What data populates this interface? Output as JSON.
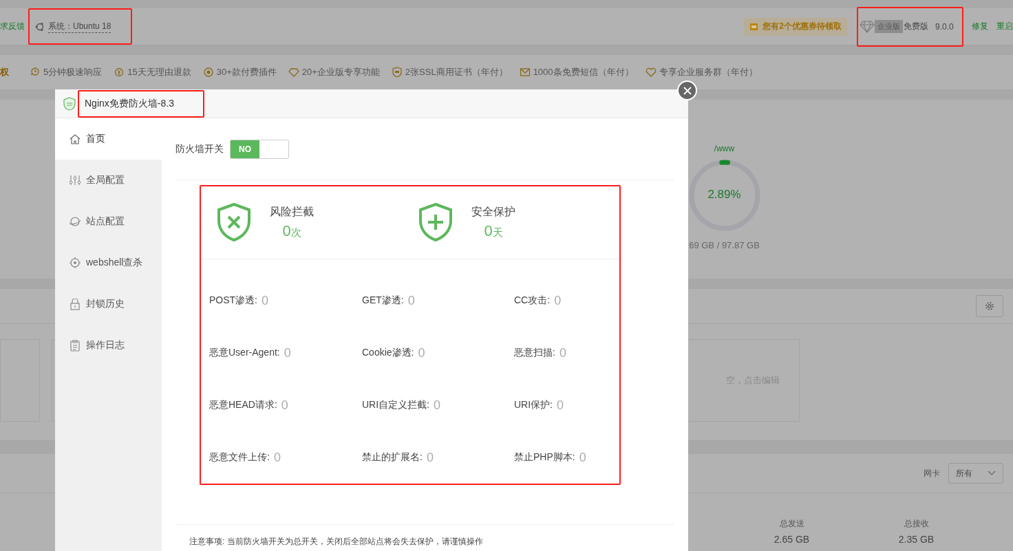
{
  "header": {
    "feedback_link": "求反馈",
    "system_label": "系统：Ubuntu 18",
    "coupon": "您有2个优惠券待领取",
    "edition_tag": "企业版",
    "edition": "免费版",
    "version": "9.0.0",
    "actions": [
      "修复",
      "重启"
    ]
  },
  "perks": [
    {
      "label": "权",
      "kind": "cut"
    },
    {
      "label": "5分钟极速响应",
      "kind": "clock"
    },
    {
      "label": "15天无理由退款",
      "kind": "refund"
    },
    {
      "label": "30+款付费插件",
      "kind": "plugin"
    },
    {
      "label": "20+企业版专享功能",
      "kind": "diamond"
    },
    {
      "label": "2张SSL商用证书（年付）",
      "kind": "ssl"
    },
    {
      "label": "1000条免费短信（年付）",
      "kind": "mail"
    },
    {
      "label": "专享企业服务群（年付）",
      "kind": "heart"
    }
  ],
  "disk": {
    "path": "/www",
    "percent": "2.89%",
    "level": 0.0289,
    "usage": "69 GB / 97.87 GB"
  },
  "memo_card": {
    "text": "空，点击编辑"
  },
  "network": {
    "label": "网卡",
    "select_value": "所有",
    "sent_label": "总发送",
    "sent_value": "2.65 GB",
    "received_label": "总接收",
    "received_value": "2.35 GB"
  },
  "modal": {
    "title": "Nginx免费防火墙-8.3",
    "sidebar": [
      {
        "label": "首页",
        "kind": "home",
        "selected": true
      },
      {
        "label": "全局配置",
        "kind": "sliders",
        "selected": false
      },
      {
        "label": "站点配置",
        "kind": "planet",
        "selected": false
      },
      {
        "label": "webshell查杀",
        "kind": "target",
        "selected": false
      },
      {
        "label": "封锁历史",
        "kind": "lock",
        "selected": false
      },
      {
        "label": "操作日志",
        "kind": "clipboard",
        "selected": false
      }
    ],
    "switch": {
      "label": "防火墙开关",
      "text": "NO",
      "on": true
    },
    "summary": [
      {
        "title": "风险拦截",
        "value": "0",
        "unit": "次",
        "kind": "cross"
      },
      {
        "title": "安全保护",
        "value": "0",
        "unit": "天",
        "kind": "plus"
      }
    ],
    "stats": [
      {
        "label": "POST渗透:",
        "value": "0"
      },
      {
        "label": "GET渗透:",
        "value": "0"
      },
      {
        "label": "CC攻击:",
        "value": "0"
      },
      {
        "label": "恶意User-Agent:",
        "value": "0"
      },
      {
        "label": "Cookie渗透:",
        "value": "0"
      },
      {
        "label": "恶意扫描:",
        "value": "0"
      },
      {
        "label": "恶意HEAD请求:",
        "value": "0"
      },
      {
        "label": "URI自定义拦截:",
        "value": "0"
      },
      {
        "label": "URI保护:",
        "value": "0"
      },
      {
        "label": "恶意文件上传:",
        "value": "0"
      },
      {
        "label": "禁止的扩展名:",
        "value": "0"
      },
      {
        "label": "禁止PHP脚本:",
        "value": "0"
      }
    ],
    "note": "注意事项: 当前防火墙开关为总开关，关闭后全部站点将会失去保护，请谨慎操作"
  }
}
